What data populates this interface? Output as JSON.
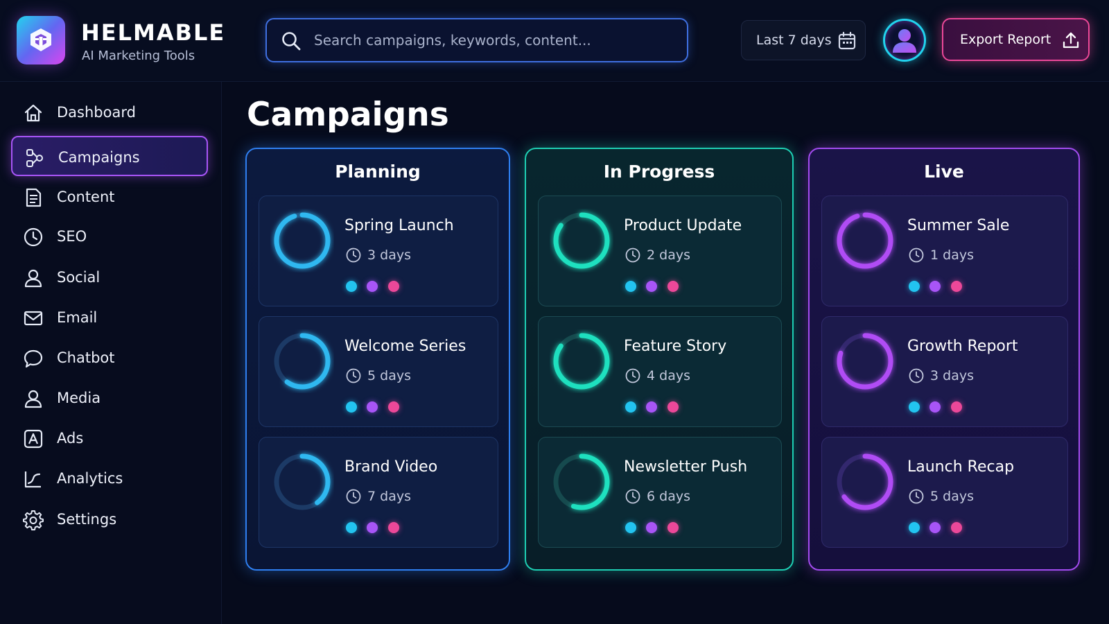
{
  "brand": {
    "name": "HELMABLE",
    "subtitle": "AI Marketing Tools"
  },
  "search": {
    "placeholder": "Search campaigns, keywords, content..."
  },
  "date_filter": {
    "label": "Last 7 days"
  },
  "export": {
    "label": "Export Report"
  },
  "sidebar": {
    "items": [
      {
        "label": "Dashboard",
        "icon": "home-icon"
      },
      {
        "label": "Campaigns",
        "icon": "campaigns-icon",
        "active": true
      },
      {
        "label": "Content",
        "icon": "document-icon"
      },
      {
        "label": "SEO",
        "icon": "clock-icon"
      },
      {
        "label": "Social",
        "icon": "user-icon"
      },
      {
        "label": "Email",
        "icon": "mail-icon"
      },
      {
        "label": "Chatbot",
        "icon": "chat-bubble-icon"
      },
      {
        "label": "Media",
        "icon": "user-icon"
      },
      {
        "label": "Ads",
        "icon": "ads-icon"
      },
      {
        "label": "Analytics",
        "icon": "analytics-icon"
      },
      {
        "label": "Settings",
        "icon": "gear-icon"
      }
    ]
  },
  "page": {
    "title": "Campaigns"
  },
  "colors": {
    "planning": "#2fb8f0",
    "in_progress": "#1ee0bf",
    "live": "#b04cf5",
    "cyan": "#22c4f0",
    "purple": "#a855f7",
    "pink": "#ec4899"
  },
  "board": {
    "columns": [
      {
        "title": "Planning",
        "cards": [
          {
            "title": "Spring Launch",
            "duration": "3 days",
            "progress": 0.95
          },
          {
            "title": "Welcome Series",
            "duration": "5 days",
            "progress": 0.6
          },
          {
            "title": "Brand Video",
            "duration": "7 days",
            "progress": 0.4
          }
        ]
      },
      {
        "title": "In Progress",
        "cards": [
          {
            "title": "Product Update",
            "duration": "2 days",
            "progress": 0.85
          },
          {
            "title": "Feature Story",
            "duration": "4 days",
            "progress": 0.85
          },
          {
            "title": "Newsletter Push",
            "duration": "6 days",
            "progress": 0.55
          }
        ]
      },
      {
        "title": "Live",
        "cards": [
          {
            "title": "Summer Sale",
            "duration": "1 days",
            "progress": 0.95
          },
          {
            "title": "Growth Report",
            "duration": "3 days",
            "progress": 0.8
          },
          {
            "title": "Launch Recap",
            "duration": "5 days",
            "progress": 0.65
          }
        ]
      }
    ]
  }
}
